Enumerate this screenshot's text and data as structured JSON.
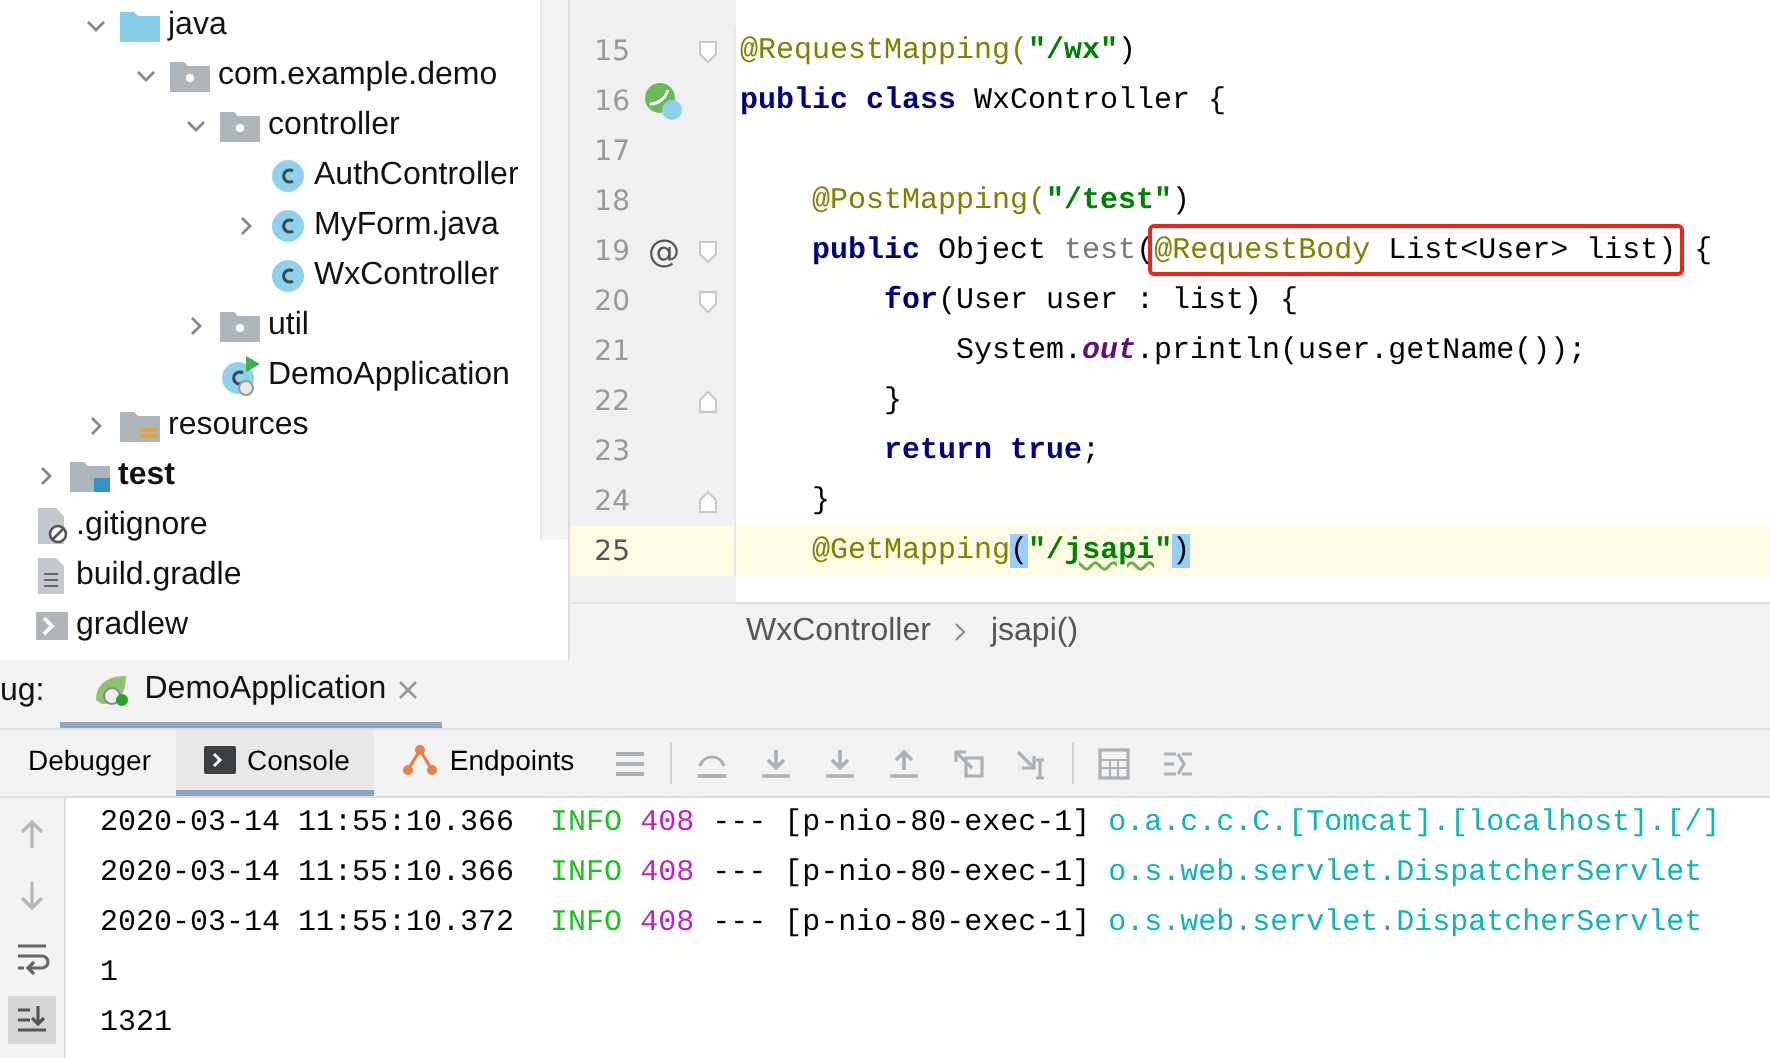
{
  "project_tree": {
    "items": [
      {
        "name": "java",
        "kind": "source-folder",
        "expanded": true,
        "children": [
          {
            "name": "com.example.demo",
            "kind": "package",
            "expanded": true,
            "children": [
              {
                "name": "controller",
                "kind": "package",
                "expanded": true,
                "children": [
                  {
                    "name": "AuthController",
                    "kind": "class"
                  },
                  {
                    "name": "MyForm.java",
                    "kind": "class",
                    "expanded": false
                  },
                  {
                    "name": "WxController",
                    "kind": "class"
                  }
                ]
              },
              {
                "name": "util",
                "kind": "package",
                "expanded": false
              },
              {
                "name": "DemoApplication",
                "kind": "run-class"
              }
            ]
          }
        ]
      },
      {
        "name": "resources",
        "kind": "resources-folder",
        "expanded": false
      },
      {
        "name": "test",
        "kind": "test-folder",
        "expanded": false
      },
      {
        "name": ".gitignore",
        "kind": "ignore-file"
      },
      {
        "name": "build.gradle",
        "kind": "gradle-file"
      },
      {
        "name": "gradlew",
        "kind": "script-file"
      }
    ]
  },
  "editor": {
    "lines": [
      {
        "number": "15",
        "marks": [
          {
            "kind": "fold-start"
          }
        ],
        "current": false,
        "tokens": [
          {
            "text": "@RequestMapping(",
            "kind": "ann"
          },
          {
            "text": "\"/wx\"",
            "kind": "str"
          },
          {
            "text": ")",
            "kind": "plain"
          }
        ]
      },
      {
        "number": "16",
        "marks": [
          {
            "kind": "bean-class"
          }
        ],
        "current": false,
        "tokens": [
          {
            "text": "public class ",
            "kind": "kw"
          },
          {
            "text": "WxController {",
            "kind": "plain"
          }
        ]
      },
      {
        "number": "17",
        "current": false
      },
      {
        "number": "18",
        "current": false,
        "tokens": [
          {
            "text": "    @PostMapping(",
            "kind": "ann"
          },
          {
            "text": "\"/test\"",
            "kind": "str"
          },
          {
            "text": ")",
            "kind": "plain"
          }
        ]
      },
      {
        "number": "19",
        "marks": [
          {
            "kind": "text",
            "text": "@"
          },
          {
            "kind": "fold-start"
          }
        ],
        "current": false,
        "tokens": [
          {
            "text": "    public ",
            "kind": "kw"
          },
          {
            "text": "Object ",
            "kind": "plain"
          },
          {
            "text": "test",
            "kind": "decl"
          },
          {
            "text": "(",
            "kind": "plain"
          },
          {
            "text": "@RequestBody ",
            "kind": "ann",
            "boxed": true
          },
          {
            "text": "List<User> list)",
            "kind": "plain",
            "boxed": true
          },
          {
            "text": " {",
            "kind": "plain"
          }
        ]
      },
      {
        "number": "20",
        "marks": [
          {
            "kind": "fold-start"
          }
        ],
        "current": false,
        "tokens": [
          {
            "text": "        for",
            "kind": "kw"
          },
          {
            "text": "(User user : list) {",
            "kind": "plain"
          }
        ]
      },
      {
        "number": "21",
        "current": false,
        "tokens": [
          {
            "text": "            System.",
            "kind": "plain"
          },
          {
            "text": "out",
            "kind": "field"
          },
          {
            "text": ".println(user.getName());",
            "kind": "plain"
          }
        ]
      },
      {
        "number": "22",
        "marks": [
          {
            "kind": "fold-end"
          }
        ],
        "current": false,
        "tokens": [
          {
            "text": "        }",
            "kind": "plain"
          }
        ]
      },
      {
        "number": "23",
        "current": false,
        "tokens": [
          {
            "text": "        return true",
            "kind": "kw"
          },
          {
            "text": ";",
            "kind": "plain"
          }
        ]
      },
      {
        "number": "24",
        "marks": [
          {
            "kind": "fold-end"
          }
        ],
        "current": false,
        "tokens": [
          {
            "text": "    }",
            "kind": "plain"
          }
        ]
      },
      {
        "number": "25",
        "current": true,
        "tokens": [
          {
            "text": "    @GetMapping",
            "kind": "ann"
          },
          {
            "text": "(",
            "kind": "brace-match"
          },
          {
            "text": "\"/",
            "kind": "str"
          },
          {
            "text": "jsapi",
            "kind": "str",
            "typo": true
          },
          {
            "text": "\"",
            "kind": "str"
          },
          {
            "text": ")",
            "kind": "brace-match"
          }
        ]
      }
    ],
    "breadcrumbs": [
      "WxController",
      "jsapi()"
    ]
  },
  "debug": {
    "label": "ug:",
    "tabs": [
      {
        "label": "DemoApplication",
        "selected": true
      }
    ],
    "view_tabs": [
      {
        "label": "Debugger",
        "kind": "plain",
        "selected": false
      },
      {
        "label": "Console",
        "kind": "console",
        "selected": true
      },
      {
        "label": "Endpoints",
        "kind": "endpoints",
        "selected": false
      }
    ],
    "console": [
      [
        {
          "text": "2020-03-14 11:55:10.366  ",
          "kind": "text"
        },
        {
          "text": "INFO ",
          "kind": "info"
        },
        {
          "text": "408",
          "kind": "pid"
        },
        {
          "text": " --- [p-nio-80-exec-1] ",
          "kind": "text"
        },
        {
          "text": "o.a.c.c.C.[Tomcat].[localhost].[/]",
          "kind": "logger"
        }
      ],
      [
        {
          "text": "2020-03-14 11:55:10.366  ",
          "kind": "text"
        },
        {
          "text": "INFO ",
          "kind": "info"
        },
        {
          "text": "408",
          "kind": "pid"
        },
        {
          "text": " --- [p-nio-80-exec-1] ",
          "kind": "text"
        },
        {
          "text": "o.s.web.servlet.DispatcherServlet",
          "kind": "logger"
        }
      ],
      [
        {
          "text": "2020-03-14 11:55:10.372  ",
          "kind": "text"
        },
        {
          "text": "INFO ",
          "kind": "info"
        },
        {
          "text": "408",
          "kind": "pid"
        },
        {
          "text": " --- [p-nio-80-exec-1] ",
          "kind": "text"
        },
        {
          "text": "o.s.web.servlet.DispatcherServlet",
          "kind": "logger"
        }
      ],
      [
        {
          "text": "1",
          "kind": "text"
        }
      ],
      [
        {
          "text": "1321",
          "kind": "text"
        }
      ]
    ]
  }
}
